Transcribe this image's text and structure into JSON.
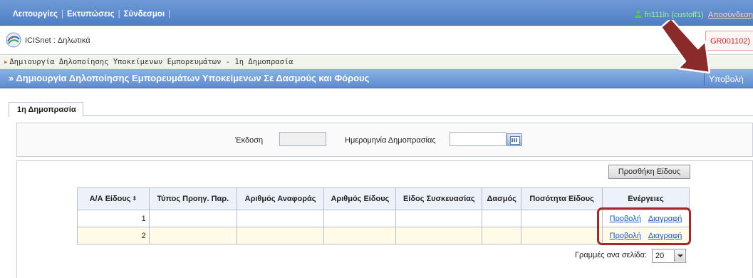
{
  "topnav": {
    "items": [
      "Λειτουργίες",
      "Εκτυπώσεις",
      "Σύνδεσμοι"
    ],
    "user_label": "fn111ln (custoff1)",
    "logout_label": "Αποσύνδεση"
  },
  "appbar": {
    "title": "ICISnet : Δηλωτικά",
    "code": "GR001102)"
  },
  "breadcrumb": {
    "text": "Δημιουργία Δηλοποίησης Υποκείμενων Εμπορευμάτων - 1η Δημοπρασία"
  },
  "page_header": {
    "title": "» Δημιουργία Δηλοποίησης Εμπορευμάτων Υποκείμενων Σε Δασμούς και Φόρους",
    "view_button": "Υποβολή"
  },
  "tabs": [
    {
      "label": "1η Δημοπρασία"
    }
  ],
  "form": {
    "version_label": "Έκδοση",
    "version_value": "",
    "date_label": "Ημερομηνία Δημοπρασίας",
    "date_value": ""
  },
  "grid": {
    "add_button": "Προσθήκη Είδους",
    "headers": [
      "Α/Α Είδους",
      "Τύπος Προηγ. Παρ.",
      "Αριθμός Αναφοράς",
      "Αριθμός Είδους",
      "Είδος Συσκευασίας",
      "Δασμός",
      "Ποσότητα Είδους",
      "Ενέργειες"
    ],
    "sort_glyph": "⬍",
    "rows": [
      {
        "aa": "1",
        "view": "Προβολή",
        "delete": "Διαγραφή"
      },
      {
        "aa": "2",
        "view": "Προβολή",
        "delete": "Διαγραφή"
      }
    ],
    "rows_per_page_label": "Γραμμές ανα σελίδα:",
    "rows_per_page_value": "20"
  },
  "colors": {
    "header_blue": "#5c8bd0",
    "annotation_red": "#a32a2a",
    "link_blue": "#1b56c8",
    "row_alt": "#fffbe6"
  }
}
